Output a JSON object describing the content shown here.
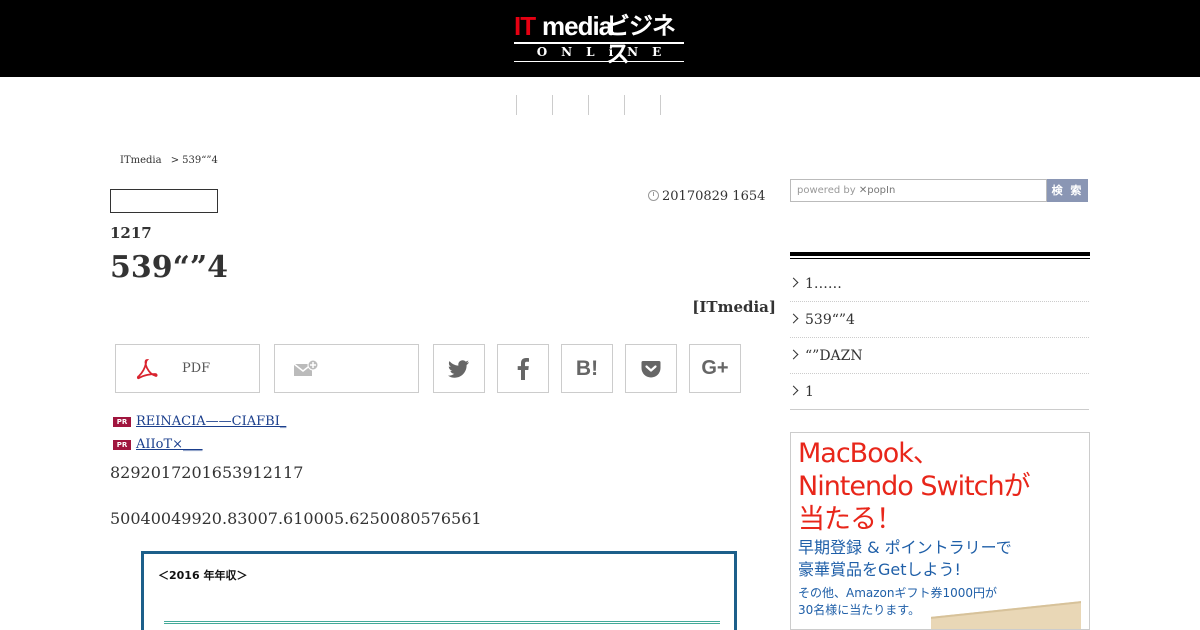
{
  "header": {
    "logo_it": "IT",
    "logo_media": "media",
    "logo_jp": "ビジネス",
    "logo_online": "ONLiNE"
  },
  "breadcrumb": {
    "home": "ITmedia",
    "separator": ">",
    "current": "539“”4"
  },
  "article": {
    "date": "20170829 1654",
    "subtitle": "1217",
    "title": "539“”4",
    "credit": "[ITmedia]",
    "pdf_label": "PDF",
    "pr_links": [
      "REINACIA——CIAFBI_",
      "AIIoT×___"
    ],
    "paragraphs": [
      "8292017201653912117",
      "50040049920.83007.610005.6250080576561"
    ],
    "figure_title": "＜2016 年年収＞"
  },
  "sidebar": {
    "search_placeholder_prefix": "powered by",
    "search_placeholder_brand": "popIn",
    "search_button": "検 索",
    "ranking": [
      "1……",
      "539“”4",
      "“”DAZN",
      "1"
    ],
    "ad": {
      "headline_1": "MacBook、",
      "headline_2": "Nintendo Switchが",
      "headline_3": "当たる！",
      "sub_1": "早期登録 & ポイントラリーで",
      "sub_2": "豪華賞品をGetしよう!",
      "note_1": "その他、Amazonギフト券1000円が",
      "note_2": "30名様に当たります。"
    }
  },
  "colors": {
    "header_bg": "#000000",
    "logo_red": "#e60012",
    "pr_badge": "#a0153e",
    "link": "#1a3e8c",
    "search_button": "#8a96b4",
    "ad_red": "#e8261a",
    "ad_blue": "#1f5fa8",
    "figure_border": "#1c5f8a"
  },
  "icons": {
    "pdf": "pdf-icon",
    "mail": "mail-add-icon",
    "twitter": "twitter-icon",
    "facebook": "facebook-icon",
    "hatena": "hatena-bookmark-icon",
    "pocket": "pocket-icon",
    "gplus": "google-plus-icon",
    "clock": "clock-icon"
  }
}
